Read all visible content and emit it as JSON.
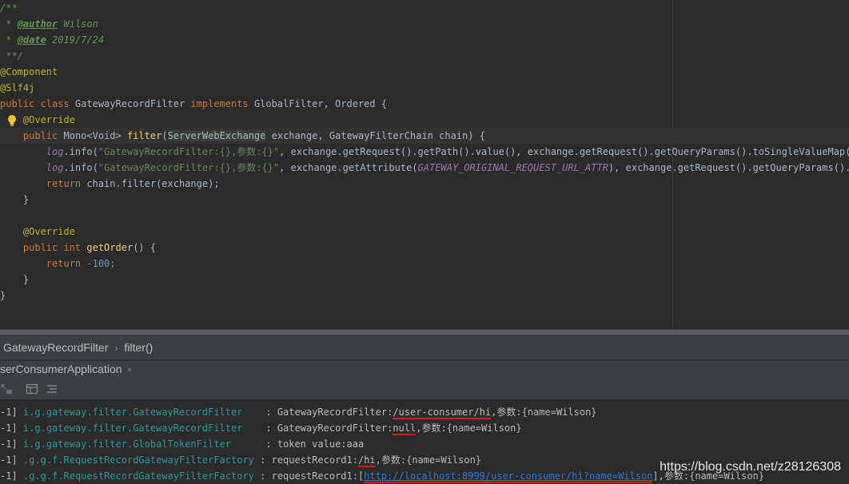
{
  "editor": {
    "javadoc_open": "/**",
    "author_tag": "@author",
    "author_value": " Wilson",
    "date_tag": "@date",
    "date_value": " 2019/7/24",
    "javadoc_close": " **/",
    "annotation_component": "@Component",
    "annotation_slf4j": "@Slf4j",
    "class_kw": "public class",
    "class_name": " GatewayRecordFilter ",
    "implements_kw": "implements",
    "interfaces": " GlobalFilter, Ordered {",
    "override1": "@Override",
    "public_kw": "public",
    "mono_type": " Mono<Void> ",
    "method_filter": "filter",
    "paren_open": "(",
    "param_type": "ServerWebExchange",
    "params_rest": " exchange, GatewayFilterChain chain) {",
    "log1_var": "log",
    "log1_call": ".info(",
    "log1_str": "\"GatewayRecordFilter:{},参数:{}\"",
    "log1_rest": ", exchange.getRequest().getPath().value(), exchange.getRequest().getQueryParams().toSingleValueMap());",
    "log2_var": "log",
    "log2_call": ".info(",
    "log2_str": "\"GatewayRecordFilter:{},参数:{}\"",
    "log2_mid": ", exchange.getAttribute(",
    "log2_const": "GATEWAY_ORIGINAL_REQUEST_URL_ATTR",
    "log2_rest": "), exchange.getRequest().getQueryParams().toSi",
    "return_kw": "return",
    "return_rest": " chain.filter(exchange);",
    "close_brace": "}",
    "override2": "@Override",
    "public_int": "public int",
    "method_getorder": " getOrder",
    "getorder_rest": "() {",
    "return_kw2": "return",
    "return_num": " -100",
    "semicolon": ";",
    "class_close": "}"
  },
  "breadcrumb": {
    "item1": "GatewayRecordFilter",
    "separator": "›",
    "item2": "filter()"
  },
  "run_panel": {
    "tab_label": "serConsumerApplication",
    "close_glyph": "×"
  },
  "console": {
    "lines": [
      {
        "prefix": "-1]",
        "logger": "i.g.gateway.filter.GatewayRecordFilter   ",
        "sep": " : ",
        "msg1": "GatewayRecordFilter:",
        "hl": "/user-consumer/hi",
        "msg2": ",参数:{name=Wilson}"
      },
      {
        "prefix": "-1]",
        "logger": "i.g.gateway.filter.GatewayRecordFilter   ",
        "sep": " : ",
        "msg1": "GatewayRecordFilter:",
        "hl": "null",
        "msg2": ",参数:{name=Wilson}"
      },
      {
        "prefix": "-1]",
        "logger": "i.g.gateway.filter.GlobalTokenFilter     ",
        "sep": " : ",
        "msg1": "token value:aaa",
        "hl": "",
        "msg2": ""
      },
      {
        "prefix": "-1]",
        "logger": ".g.g.f.RequestRecordGatewayFilterFactory",
        "sep": " : ",
        "msg1": "requestRecord1:",
        "hl": "/hi",
        "msg2": ",参数:{name=Wilson}"
      },
      {
        "prefix": "-1]",
        "logger": ".g.g.f.RequestRecordGatewayFilterFactory",
        "sep": " : ",
        "msg1": "requestRecord1:[",
        "url": "http://localhost:8999/user-consumer/hi?name=Wilson",
        "msg2": "],参数:{name=Wilson}"
      }
    ]
  },
  "watermark": "https://blog.csdn.net/z28126308",
  "colors": {
    "editor_bg": "#2b2b2b",
    "panel_bg": "#3c3f41",
    "keyword": "#cc7832",
    "annotation": "#bbb529",
    "string": "#6a8759",
    "logger": "#299999",
    "link": "#287bde",
    "red_mark": "#e0161b"
  },
  "icons": [
    "lightbulb-icon",
    "layout-icon",
    "list-icon",
    "pin-icon"
  ]
}
